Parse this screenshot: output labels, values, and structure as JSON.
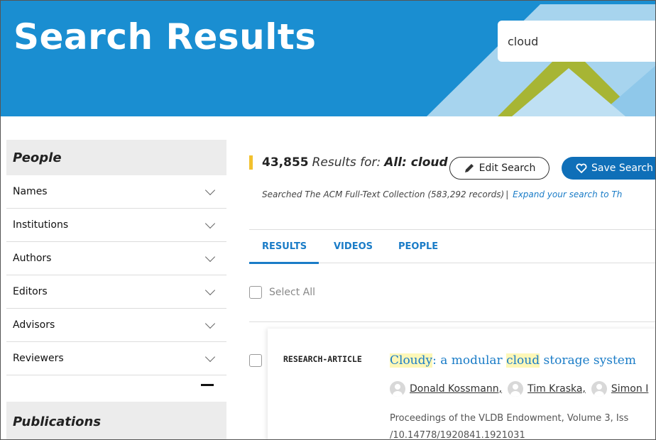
{
  "header": {
    "title": "Search Results",
    "search_value": "cloud",
    "background_color": "#1a8ed1",
    "accent_color": "#a7b534"
  },
  "sidebar": {
    "people_heading": "People",
    "items": [
      {
        "label": "Names"
      },
      {
        "label": "Institutions"
      },
      {
        "label": "Authors"
      },
      {
        "label": "Editors"
      },
      {
        "label": "Advisors"
      },
      {
        "label": "Reviewers"
      }
    ],
    "publications_heading": "Publications"
  },
  "results": {
    "count": "43,855",
    "results_for": "Results for:",
    "query": "All: cloud",
    "edit_search_label": "Edit Search",
    "save_search_label": "Save Search",
    "searched_text": "Searched The ACM Full-Text Collection (583,292 records)",
    "separator": "|",
    "expand_text": "Expand your search to Th",
    "select_all_label": "Select All"
  },
  "tabs": [
    {
      "label": "RESULTS",
      "active": true
    },
    {
      "label": "VIDEOS"
    },
    {
      "label": "PEOPLE"
    }
  ],
  "result_item": {
    "type": "RESEARCH-ARTICLE",
    "title_part1": "Cloudy",
    "title_part2": ": a modular ",
    "title_part3": "cloud",
    "title_part4": " storage system",
    "authors": [
      "Donald Kossmann,",
      "Tim Kraska,",
      "Simon I"
    ],
    "venue": "Proceedings of the VLDB Endowment, Volume 3, Iss",
    "doi": "/10.14778/1920841.1921031"
  }
}
